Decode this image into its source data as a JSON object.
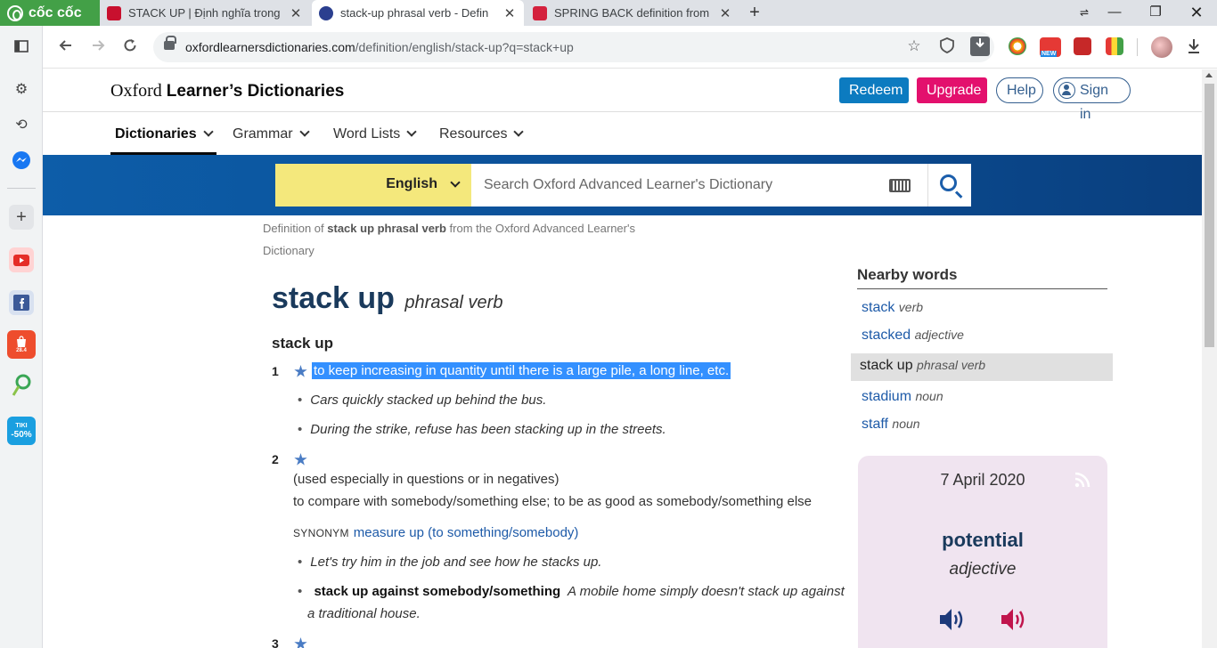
{
  "browser": {
    "brand": "cốc cốc",
    "tabs": [
      {
        "title": "STACK UP | Định nghĩa trong",
        "close": "✕"
      },
      {
        "title": "stack-up phrasal verb - Defin",
        "close": "✕"
      },
      {
        "title": "SPRING BACK definition from",
        "close": "✕"
      }
    ],
    "new_tab": "+",
    "url_host": "oxfordlearnersdictionaries.com",
    "url_path": "/definition/english/stack-up?q=stack+up"
  },
  "sidebar": {
    "items": [
      "toggle-panel",
      "settings",
      "history",
      "messenger",
      "add",
      "youtube",
      "facebook",
      "shopee",
      "coccoc-app",
      "tiki"
    ],
    "shopee_badge": "28.4",
    "tiki_label": "TIKI",
    "tiki_discount": "-50%"
  },
  "site": {
    "logo_oxford": "Oxford",
    "logo_rest": "Learner’s Dictionaries",
    "redeem": "Redeem",
    "upgrade": "Upgrade",
    "help": "Help",
    "sign_in": "Sign in",
    "nav": [
      "Dictionaries",
      "Grammar",
      "Word Lists",
      "Resources"
    ],
    "language": "English",
    "search_placeholder": "Search Oxford Advanced Learner's Dictionary"
  },
  "entry": {
    "source_prefix": "Definition of ",
    "source_term": "stack up phrasal verb",
    "source_suffix": " from the Oxford Advanced Learner's Dictionary",
    "headword": "stack up",
    "pos": "phrasal verb",
    "phrase": "stack up",
    "senses": [
      {
        "num": "1",
        "definition": "to keep increasing in quantity until there is a large pile, a long line, etc.",
        "examples": [
          "Cars quickly stacked up behind the bus.",
          "During the strike, refuse has been stacking up in the streets."
        ]
      },
      {
        "num": "2",
        "grammar": "(used especially in questions or in negatives)",
        "definition": "to compare with somebody/something else; to be as good as somebody/something else",
        "synonym_label": "SYNONYM",
        "synonym": "measure up (to something/somebody)",
        "examples": [
          "Let's try him in the job and see how he stacks up."
        ],
        "collocation": "stack up against somebody/something",
        "collocation_example_1": "A mobile home simply doesn't stack up against",
        "collocation_example_2": "a traditional house."
      },
      {
        "num": "3"
      }
    ]
  },
  "nearby": {
    "heading": "Nearby words",
    "items": [
      {
        "word": "stack",
        "pos": "verb"
      },
      {
        "word": "stacked",
        "pos": "adjective"
      },
      {
        "word": "stack up",
        "pos": "phrasal verb"
      },
      {
        "word": "stadium",
        "pos": "noun"
      },
      {
        "word": "staff",
        "pos": "noun"
      }
    ]
  },
  "word_of_the_day": {
    "date": "7 April 2020",
    "word": "potential",
    "pos": "adjective",
    "uk_color": "#1d3a7a",
    "us_color": "#c0144c"
  }
}
